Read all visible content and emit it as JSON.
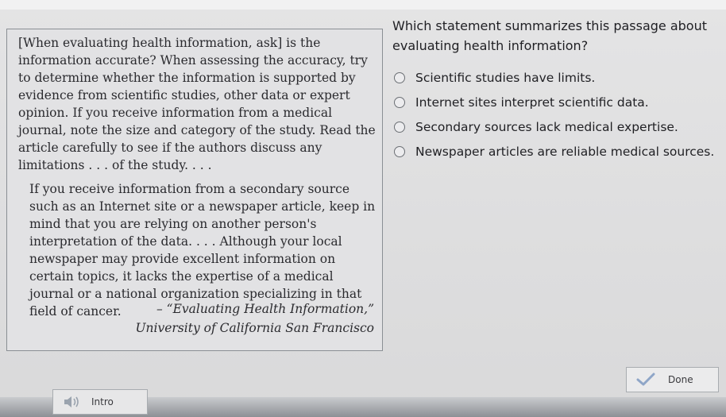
{
  "passage": {
    "paragraph_1": "[When evaluating health information, ask] is the information accurate? When assessing the accuracy, try to determine whether the information is supported by evidence from scientific studies, other data or expert opinion. If you receive information from a medical journal, note the size and category of the study. Read the article carefully to see if the authors discuss any limitations . . . of the study. . . .",
    "paragraph_2": "If you receive information from a secondary source such as an Internet site or a newspaper article, keep in mind that you are relying on another person's interpretation of the data. . . . Although your local newspaper may provide excellent information on certain topics, it lacks the expertise of a medical journal or a national organization specializing in that field of cancer.",
    "attribution_title": "– “Evaluating Health Information,”",
    "attribution_source": "University of California San Francisco"
  },
  "question": {
    "text": "Which statement summarizes this passage about evaluating health information?",
    "options": [
      {
        "label": "Scientific studies have limits.",
        "selected": false
      },
      {
        "label": "Internet sites interpret scientific data.",
        "selected": false
      },
      {
        "label": "Secondary sources lack medical expertise.",
        "selected": false
      },
      {
        "label": "Newspaper articles are reliable medical sources.",
        "selected": false
      }
    ]
  },
  "buttons": {
    "done_label": "Done",
    "done_icon": "check-icon",
    "intro_label": "Intro",
    "intro_icon": "speaker-icon"
  },
  "colors": {
    "check": "#8fa6c8",
    "speaker": "#9aa3ae"
  }
}
